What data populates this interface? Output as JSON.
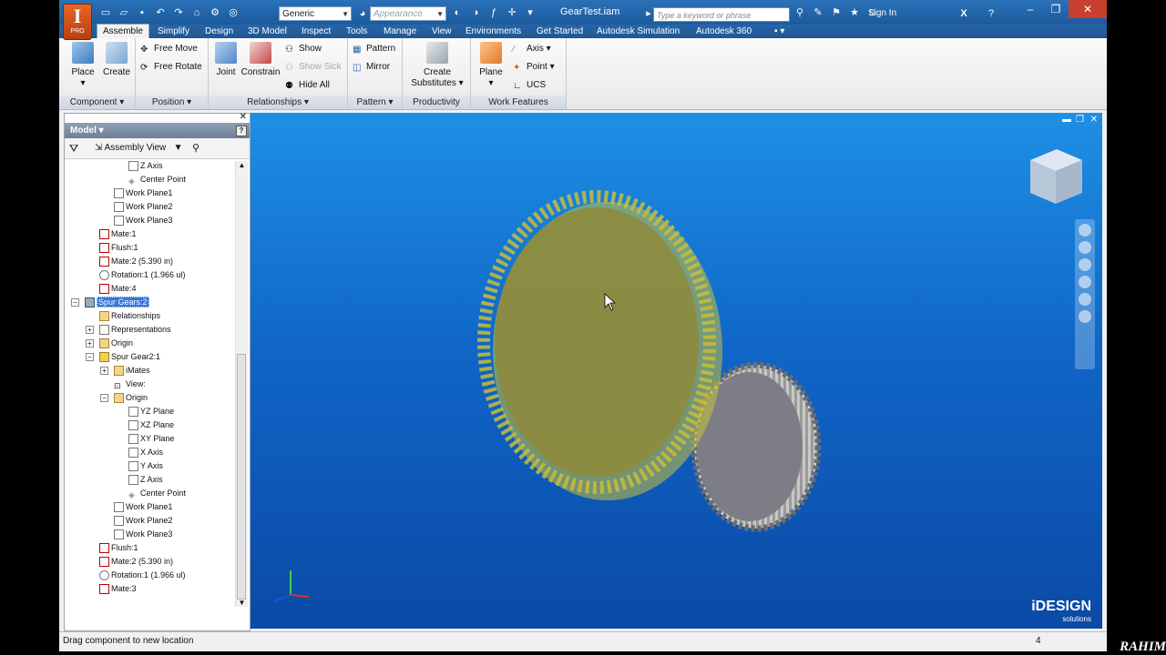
{
  "app": {
    "logo_letter": "I",
    "logo_sub": "PRO",
    "document_title": "GearTest.iam",
    "combo_material": "Generic",
    "combo_appearance": "Appearance",
    "search_placeholder": "Type a keyword or phrase",
    "sign_in": "Sign In"
  },
  "tabs": [
    "Assemble",
    "Simplify",
    "Design",
    "3D Model",
    "Inspect",
    "Tools",
    "Manage",
    "View",
    "Environments",
    "Get Started",
    "Autodesk Simulation",
    "Autodesk 360"
  ],
  "ribbon": {
    "component": {
      "place": "Place",
      "create": "Create",
      "label": "Component ▾"
    },
    "position": {
      "free_move": "Free Move",
      "free_rotate": "Free Rotate",
      "label": "Position ▾"
    },
    "relationships": {
      "joint": "Joint",
      "constrain": "Constrain",
      "show": "Show",
      "show_sick": "Show Sick",
      "hide_all": "Hide All",
      "label": "Relationships ▾"
    },
    "pattern": {
      "pattern": "Pattern",
      "mirror": "Mirror",
      "label": "Pattern ▾"
    },
    "productivity": {
      "create_substitutes_1": "Create",
      "create_substitutes_2": "Substitutes",
      "label": "Productivity"
    },
    "work_features": {
      "plane": "Plane",
      "axis": "Axis",
      "point": "Point",
      "ucs": "UCS",
      "label": "Work Features"
    }
  },
  "browser": {
    "title": "Model ▾",
    "view": "Assembly View",
    "nodes": [
      {
        "label": "Z Axis"
      },
      {
        "label": "Center Point"
      },
      {
        "label": "Work Plane1"
      },
      {
        "label": "Work Plane2"
      },
      {
        "label": "Work Plane3"
      },
      {
        "label": "Mate:1"
      },
      {
        "label": "Flush:1"
      },
      {
        "label": "Mate:2 (5.390 in)"
      },
      {
        "label": "Rotation:1 (1.966 ul)"
      },
      {
        "label": "Mate:4"
      },
      {
        "label": "Spur Gears:2"
      },
      {
        "label": "Relationships"
      },
      {
        "label": "Representations"
      },
      {
        "label": "Origin"
      },
      {
        "label": "Spur Gear2:1"
      },
      {
        "label": "iMates"
      },
      {
        "label": "View:"
      },
      {
        "label": "Origin"
      },
      {
        "label": "YZ Plane"
      },
      {
        "label": "XZ Plane"
      },
      {
        "label": "XY Plane"
      },
      {
        "label": "X Axis"
      },
      {
        "label": "Y Axis"
      },
      {
        "label": "Z Axis"
      },
      {
        "label": "Center Point"
      },
      {
        "label": "Work Plane1"
      },
      {
        "label": "Work Plane2"
      },
      {
        "label": "Work Plane3"
      },
      {
        "label": "Flush:1"
      },
      {
        "label": "Mate:2 (5.390 in)"
      },
      {
        "label": "Rotation:1 (1.966 ul)"
      },
      {
        "label": "Mate:3"
      }
    ]
  },
  "status": {
    "message": "Drag component to new location",
    "count": "4"
  },
  "watermark": {
    "brand": "iDESIGN",
    "sub": "solutions",
    "corner": "RAHIM"
  }
}
